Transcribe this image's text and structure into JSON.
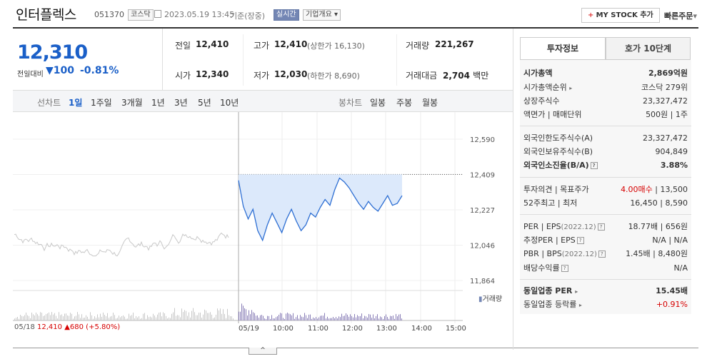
{
  "header": {
    "name": "인터플렉스",
    "code": "051370",
    "market_badge": "코스닥",
    "datetime": "2023.05.19 13:45",
    "basis": "기준(장중)",
    "realtime_badge": "실시간",
    "company_overview": "기업개요",
    "mystock_button": "MY STOCK 추가",
    "quick_order": "빠른주문"
  },
  "price": {
    "current": "12,310",
    "change_label": "전일대비",
    "change": "100",
    "change_pct": "-0.81%"
  },
  "summary": {
    "prev_close_label": "전일",
    "prev_close": "12,410",
    "high_label": "고가",
    "high": "12,410",
    "upper_limit": "(상한가 16,130)",
    "volume_label": "거래량",
    "volume": "221,267",
    "open_label": "시가",
    "open": "12,340",
    "low_label": "저가",
    "low": "12,030",
    "lower_limit": "(하한가 8,690)",
    "amount_label": "거래대금",
    "amount": "2,704",
    "amount_unit": "백만"
  },
  "tabs": {
    "line_label": "선차트",
    "line": [
      "1일",
      "1주일",
      "3개월",
      "1년",
      "3년",
      "5년",
      "10년"
    ],
    "candle_label": "봉차트",
    "candle": [
      "일봉",
      "주봉",
      "월봉"
    ]
  },
  "chart_data": {
    "type": "line",
    "y_ticks": [
      "12,590",
      "12,409",
      "12,227",
      "12,046",
      "11,864"
    ],
    "ylim": [
      11864,
      12590
    ],
    "reference_price": 12409,
    "x_ticks": [
      "05/19",
      "10:00",
      "11:00",
      "12:00",
      "13:00",
      "14:00",
      "15:00"
    ],
    "volume_label": "거래량",
    "prev_day_label": "05/18",
    "prev_day_close": "12,410",
    "prev_day_change": "▲680",
    "prev_day_pct": "(+5.80%)",
    "series": [
      {
        "values": [
          12378,
          12245,
          12180,
          12230,
          12120,
          12070,
          12150,
          12210,
          12160,
          12110,
          12180,
          12230,
          12170,
          12120,
          12150,
          12210,
          12190,
          12240,
          12280,
          12250,
          12330,
          12390,
          12370,
          12340,
          12300,
          12260,
          12230,
          12270,
          12240,
          12220,
          12260,
          12300,
          12250,
          12260,
          12300
        ]
      }
    ]
  },
  "invest": {
    "tab1": "투자정보",
    "tab2": "호가 10단계",
    "market_cap_label": "시가총액",
    "market_cap": "2,869억원",
    "rank_label": "시가총액순위",
    "rank": "코스닥 279위",
    "shares_label": "상장주식수",
    "shares": "23,327,472",
    "par_label": "액면가 | 매매단위",
    "par": "500원 | 1주",
    "foreign_limit_label": "외국인한도주식수(A)",
    "foreign_limit": "23,327,472",
    "foreign_hold_label": "외국인보유주식수(B)",
    "foreign_hold": "904,849",
    "foreign_ratio_label": "외국인소진율(B/A)",
    "foreign_ratio": "3.88%",
    "opinion_label": "투자의견 | 목표주가",
    "opinion": "4.00매수",
    "target": "| 13,500",
    "w52_label": "52주최고 | 최저",
    "w52": "16,450 | 8,590",
    "per_label": "PER | EPS",
    "per_date": "(2022.12)",
    "per": "18.77배 | 656원",
    "est_per_label": "추정PER | EPS",
    "est_per": "N/A | N/A",
    "pbr_label": "PBR | BPS",
    "pbr_date": "(2022.12)",
    "pbr": "1.45배 | 8,480원",
    "div_label": "배당수익률",
    "div": "N/A",
    "sector_per_label": "동일업종 PER",
    "sector_per": "15.45배",
    "sector_rate_label": "동일업종 등락률",
    "sector_rate": "+0.91%"
  },
  "colors": {
    "up": "#d60000",
    "down": "#1a5fc8",
    "fill": "#dce9fb"
  }
}
